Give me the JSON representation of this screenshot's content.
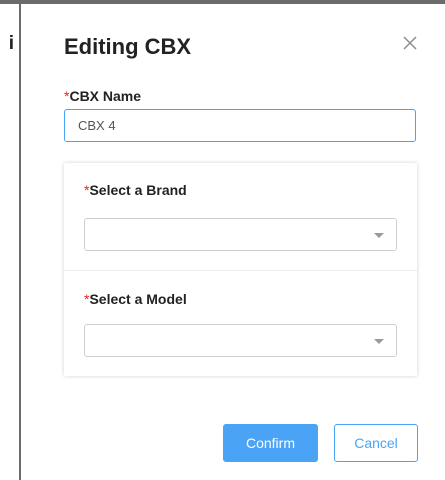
{
  "background": {
    "partial_glyph": "i"
  },
  "dialog": {
    "title": "Editing CBX",
    "close_icon": "close-x-icon",
    "required_mark": "*",
    "name_field": {
      "label": "CBX Name",
      "value": "CBX 4"
    },
    "brand_field": {
      "label": "Select a Brand",
      "value": ""
    },
    "model_field": {
      "label": "Select a Model",
      "value": ""
    },
    "confirm_label": "Confirm",
    "cancel_label": "Cancel"
  },
  "colors": {
    "accent": "#4aa3f4",
    "required": "#e0281b",
    "text": "#222222"
  }
}
